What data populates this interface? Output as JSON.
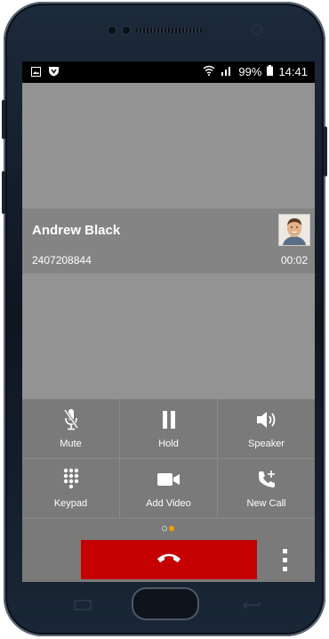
{
  "status_bar": {
    "battery": "99%",
    "time": "14:41",
    "left_icons": [
      "image-icon",
      "shield-icon"
    ],
    "right_icons": [
      "wifi-icon",
      "signal-icon",
      "battery-icon"
    ]
  },
  "call": {
    "contact_name": "Andrew Black",
    "contact_number": "2407208844",
    "duration": "00:02"
  },
  "controls": [
    {
      "label": "Mute",
      "icon": "mic-off-icon"
    },
    {
      "label": "Hold",
      "icon": "pause-icon"
    },
    {
      "label": "Speaker",
      "icon": "speaker-icon"
    },
    {
      "label": "Keypad",
      "icon": "keypad-icon"
    },
    {
      "label": "Add Video",
      "icon": "video-camera-icon"
    },
    {
      "label": "New Call",
      "icon": "phone-add-icon"
    }
  ],
  "pager": {
    "pages": 2,
    "active": 2
  },
  "colors": {
    "end_call": "#c40000",
    "pager_active": "#f0a000",
    "pager_inactive": "#d0d0d0",
    "controls_bg": "#7a7a7a",
    "screen_bg": "#939393"
  }
}
